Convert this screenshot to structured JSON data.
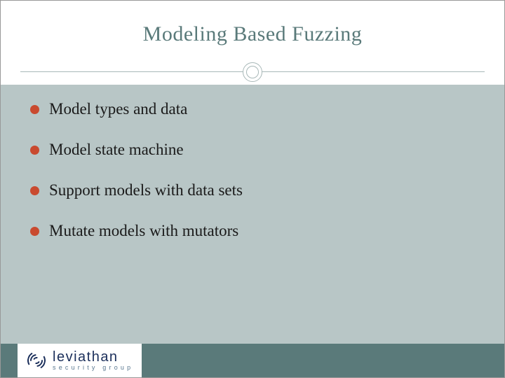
{
  "title": "Modeling Based Fuzzing",
  "bullets": [
    "Model types and data",
    "Model state machine",
    "Support models with data sets",
    "Mutate models with mutators"
  ],
  "logo": {
    "name": "leviathan",
    "subtitle": "security group"
  },
  "colors": {
    "title": "#5a7a7a",
    "bullet": "#c94a2f",
    "content_bg": "#b8c6c6",
    "footer": "#5a7a7a",
    "logo": "#1a2e5a"
  }
}
